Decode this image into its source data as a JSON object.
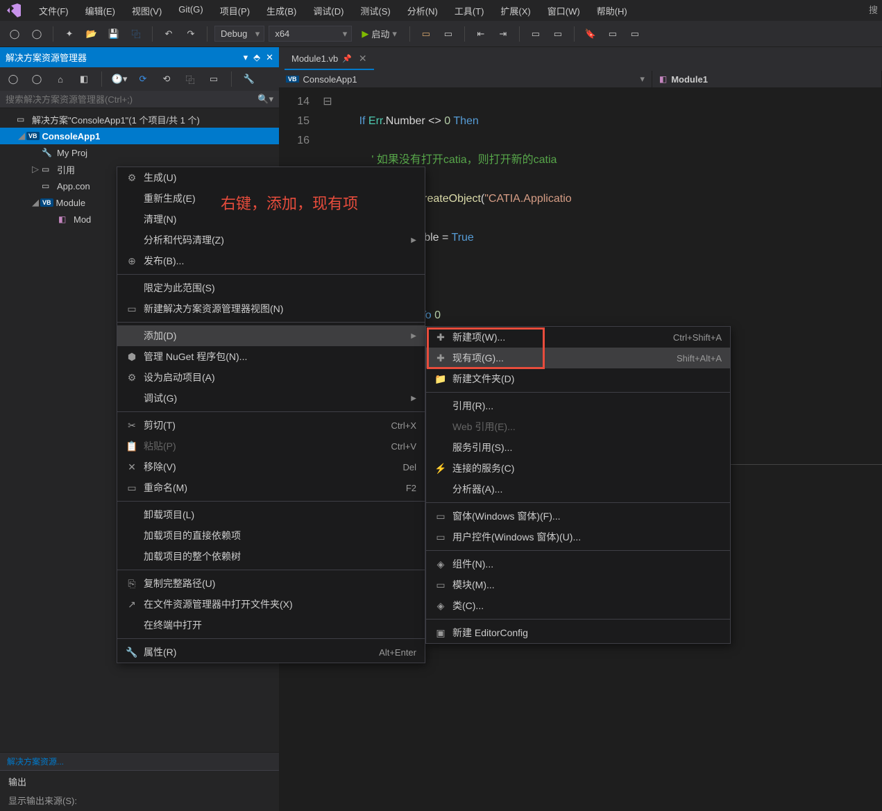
{
  "menubar": {
    "items": [
      "文件(F)",
      "编辑(E)",
      "视图(V)",
      "Git(G)",
      "项目(P)",
      "生成(B)",
      "调试(D)",
      "测试(S)",
      "分析(N)",
      "工具(T)",
      "扩展(X)",
      "窗口(W)",
      "帮助(H)"
    ]
  },
  "toolbar": {
    "config": "Debug",
    "platform": "x64",
    "start": "启动"
  },
  "search_corner": "搜",
  "solution": {
    "title": "解决方案资源管理器",
    "search_placeholder": "搜索解决方案资源管理器(Ctrl+;)",
    "root": "解决方案\"ConsoleApp1\"(1 个项目/共 1 个)",
    "project": "ConsoleApp1",
    "nodes": {
      "myproj": "My Proj",
      "refs": "引用",
      "appcon": "App.con",
      "module": "Module",
      "mod": "Mod"
    },
    "bottom_tab": "解决方案资源..."
  },
  "output": {
    "title": "输出",
    "source_label": "显示输出来源(S):"
  },
  "editor": {
    "tab": "Module1.vb",
    "nav_project": "ConsoleApp1",
    "nav_module": "Module1",
    "line_numbers": [
      "14",
      "15",
      "16"
    ]
  },
  "annotation_text": "右键，添加，现有项",
  "context_menu_1": {
    "items": [
      {
        "icon": "⚙",
        "label": "生成(U)",
        "shortcut": "",
        "type": "item"
      },
      {
        "label": "重新生成(E)",
        "type": "item"
      },
      {
        "label": "清理(N)",
        "type": "item"
      },
      {
        "label": "分析和代码清理(Z)",
        "arrow": true,
        "type": "item"
      },
      {
        "icon": "⊕",
        "label": "发布(B)...",
        "type": "item"
      },
      {
        "type": "sep"
      },
      {
        "label": "限定为此范围(S)",
        "type": "item"
      },
      {
        "icon": "▭",
        "label": "新建解决方案资源管理器视图(N)",
        "type": "item"
      },
      {
        "type": "sep"
      },
      {
        "label": "添加(D)",
        "arrow": true,
        "highlight": true,
        "type": "item"
      },
      {
        "icon": "⬢",
        "label": "管理 NuGet 程序包(N)...",
        "type": "item"
      },
      {
        "icon": "⚙",
        "label": "设为启动项目(A)",
        "type": "item"
      },
      {
        "label": "调试(G)",
        "arrow": true,
        "type": "item"
      },
      {
        "type": "sep"
      },
      {
        "icon": "✂",
        "label": "剪切(T)",
        "shortcut": "Ctrl+X",
        "type": "item"
      },
      {
        "icon": "📋",
        "label": "粘贴(P)",
        "shortcut": "Ctrl+V",
        "disabled": true,
        "type": "item"
      },
      {
        "icon": "✕",
        "label": "移除(V)",
        "shortcut": "Del",
        "type": "item"
      },
      {
        "icon": "▭",
        "label": "重命名(M)",
        "shortcut": "F2",
        "type": "item"
      },
      {
        "type": "sep"
      },
      {
        "label": "卸载项目(L)",
        "type": "item"
      },
      {
        "label": "加载项目的直接依赖项",
        "type": "item"
      },
      {
        "label": "加载项目的整个依赖树",
        "type": "item"
      },
      {
        "type": "sep"
      },
      {
        "icon": "⎘",
        "label": "复制完整路径(U)",
        "type": "item"
      },
      {
        "icon": "↗",
        "label": "在文件资源管理器中打开文件夹(X)",
        "type": "item"
      },
      {
        "label": "在终端中打开",
        "type": "item"
      },
      {
        "type": "sep"
      },
      {
        "icon": "🔧",
        "label": "属性(R)",
        "shortcut": "Alt+Enter",
        "type": "item"
      }
    ]
  },
  "context_menu_2": {
    "items": [
      {
        "icon": "✚",
        "label": "新建项(W)...",
        "shortcut": "Ctrl+Shift+A",
        "type": "item"
      },
      {
        "icon": "✚",
        "label": "现有项(G)...",
        "shortcut": "Shift+Alt+A",
        "highlight": true,
        "type": "item"
      },
      {
        "icon": "📁",
        "label": "新建文件夹(D)",
        "type": "item"
      },
      {
        "type": "sep"
      },
      {
        "label": "引用(R)...",
        "type": "item"
      },
      {
        "label": "Web 引用(E)...",
        "disabled": true,
        "type": "item"
      },
      {
        "label": "服务引用(S)...",
        "type": "item"
      },
      {
        "icon": "⚡",
        "label": "连接的服务(C)",
        "type": "item"
      },
      {
        "label": "分析器(A)...",
        "type": "item"
      },
      {
        "type": "sep"
      },
      {
        "icon": "▭",
        "label": "窗体(Windows 窗体)(F)...",
        "type": "item"
      },
      {
        "icon": "▭",
        "label": "用户控件(Windows 窗体)(U)...",
        "type": "item"
      },
      {
        "type": "sep"
      },
      {
        "icon": "◈",
        "label": "组件(N)...",
        "type": "item"
      },
      {
        "icon": "▭",
        "label": "模块(M)...",
        "type": "item"
      },
      {
        "icon": "◈",
        "label": "类(C)...",
        "type": "item"
      },
      {
        "type": "sep"
      },
      {
        "icon": "▣",
        "label": "新建 EditorConfig",
        "type": "item"
      }
    ]
  }
}
